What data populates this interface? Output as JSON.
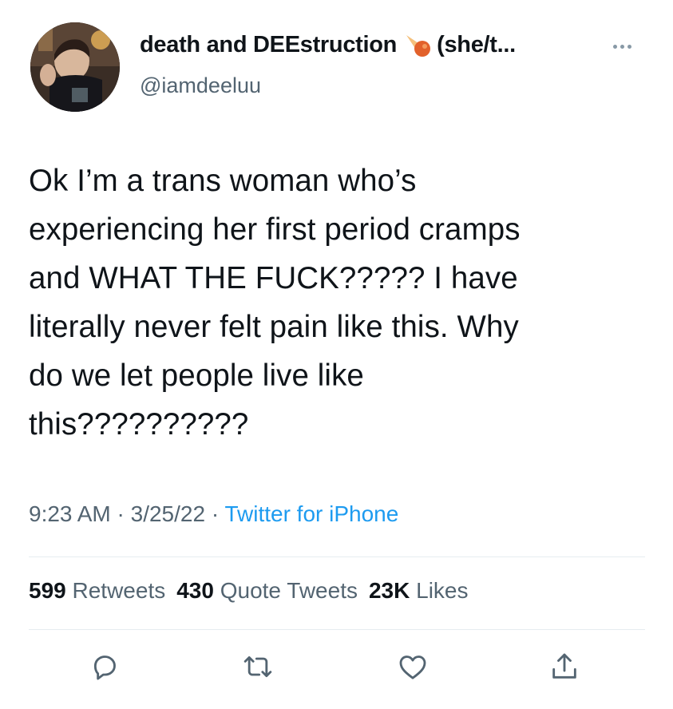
{
  "user": {
    "display_name": "death and DEEstruction",
    "pronouns": "(she/t...",
    "handle": "@iamdeeluu",
    "emoji_icon": "meteor-emoji-icon"
  },
  "tweet": {
    "lines": [
      "Ok I’m a trans woman who’s",
      "experiencing her first period cramps",
      "and WHAT THE FUCK????? I have",
      "literally never felt pain like this. Why",
      "do we let people live like",
      "this??????????"
    ]
  },
  "meta": {
    "time": "9:23 AM",
    "sep1": " · ",
    "date": "3/25/22",
    "sep2": " · ",
    "source": "Twitter for iPhone"
  },
  "stats": {
    "retweets_count": "599",
    "retweets_label": "Retweets",
    "quotes_count": "430",
    "quotes_label": "Quote Tweets",
    "likes_count": "23K",
    "likes_label": "Likes"
  },
  "actions": {
    "reply_icon": "reply-icon",
    "retweet_icon": "retweet-icon",
    "like_icon": "like-icon",
    "share_icon": "share-icon"
  },
  "colors": {
    "text": "#0f1419",
    "secondary": "#536471",
    "link": "#1d9bf0",
    "divider": "#e6ecf0"
  }
}
